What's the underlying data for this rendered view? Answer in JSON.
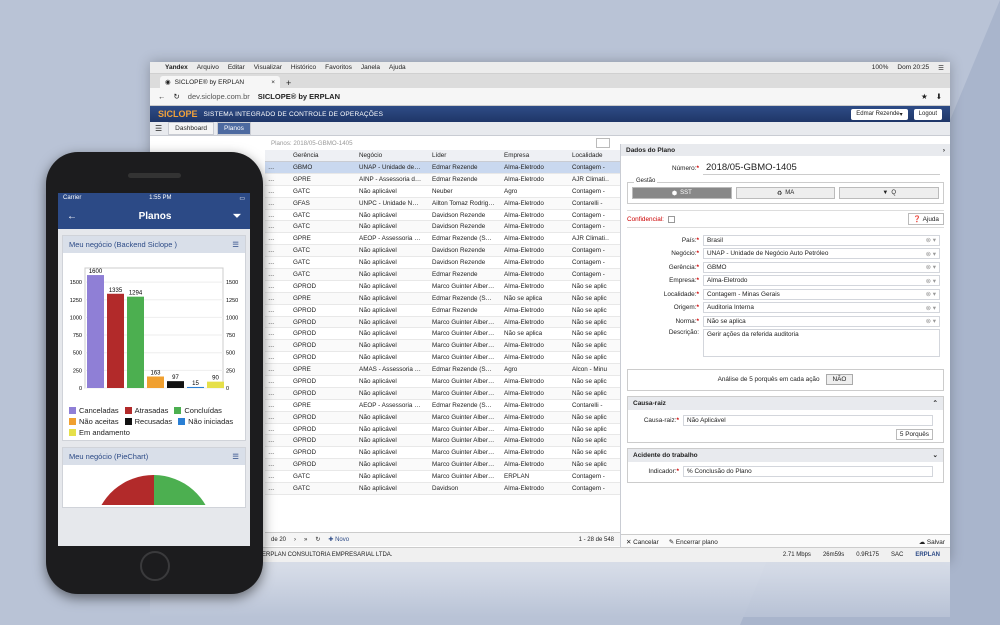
{
  "mac": {
    "apple": "",
    "app": "Yandex",
    "menus": [
      "Arquivo",
      "Editar",
      "Visualizar",
      "Histórico",
      "Favoritos",
      "Janela",
      "Ajuda"
    ],
    "battery": "100%",
    "clock": "Dom 20:25"
  },
  "browser": {
    "tab": "SICLOPE® by ERPLAN",
    "url": "dev.siclope.com.br",
    "page_title": "SICLOPE® by ERPLAN"
  },
  "app": {
    "logo": "SICLOPE",
    "subtitle": "SISTEMA INTEGRADO DE CONTROLE DE OPERAÇÕES",
    "user": "Edmar Rezende",
    "logout": "Logout",
    "tabs": [
      "Dashboard",
      "Planos"
    ],
    "breadcrumb": "Planos: 2018/05-GBMO-1405"
  },
  "grid": {
    "headers": [
      "",
      "Gerência",
      "Negócio",
      "Líder",
      "Empresa",
      "Localidade"
    ],
    "rows": [
      [
        "…",
        "GBMO",
        "UNAP - Unidade de…",
        "Edmar Rezende",
        "Alma-Eletrodo",
        "Contagem -"
      ],
      [
        "…",
        "GPRE",
        "AINP - Assessoria d…",
        "Edmar Rezende",
        "Alma-Eletrodo",
        "AJR Climati…"
      ],
      [
        "…",
        "GATC",
        "Não aplicável",
        "Neuber",
        "Agro",
        "Contagem -"
      ],
      [
        "…",
        "GFAS",
        "UNPC - Unidade N…",
        "Ailton Tomaz Rodrig…",
        "Alma-Eletrodo",
        "Contarelli -"
      ],
      [
        "…",
        "GATC",
        "Não aplicável",
        "Davidson Rezende",
        "Alma-Eletrodo",
        "Contagem -"
      ],
      [
        "…",
        "GATC",
        "Não aplicável",
        "Davidson Rezende",
        "Alma-Eletrodo",
        "Contagem -"
      ],
      [
        "…",
        "GPRE",
        "AEOP - Assessoria …",
        "Edmar Rezende (S…",
        "Alma-Eletrodo",
        "AJR Climati…"
      ],
      [
        "…",
        "GATC",
        "Não aplicável",
        "Davidson Rezende",
        "Alma-Eletrodo",
        "Contagem -"
      ],
      [
        "…",
        "GATC",
        "Não aplicável",
        "Davidson Rezende",
        "Alma-Eletrodo",
        "Contagem -"
      ],
      [
        "…",
        "GATC",
        "Não aplicável",
        "Edmar Rezende",
        "Alma-Eletrodo",
        "Contagem -"
      ],
      [
        "…",
        "GPROD",
        "Não aplicável",
        "Marco Guinter Alber…",
        "Alma-Eletrodo",
        "Não se aplic"
      ],
      [
        "…",
        "GPRE",
        "Não aplicável",
        "Edmar Rezende (S…",
        "Não se aplica",
        "Não se aplic"
      ],
      [
        "…",
        "GPROD",
        "Não aplicável",
        "Edmar Rezende",
        "Alma-Eletrodo",
        "Não se aplic"
      ],
      [
        "…",
        "GPROD",
        "Não aplicável",
        "Marco Guinter Alber…",
        "Alma-Eletrodo",
        "Não se aplic"
      ],
      [
        "…",
        "GPROD",
        "Não aplicável",
        "Marco Guinter Alber…",
        "Não se aplica",
        "Não se aplic"
      ],
      [
        "…",
        "GPROD",
        "Não aplicável",
        "Marco Guinter Alber…",
        "Alma-Eletrodo",
        "Não se aplic"
      ],
      [
        "…",
        "GPROD",
        "Não aplicável",
        "Marco Guinter Alber…",
        "Alma-Eletrodo",
        "Não se aplic"
      ],
      [
        "…",
        "GPRE",
        "AMAS - Assessoria …",
        "Edmar Rezende (S…",
        "Agro",
        "Alcon - Minu"
      ],
      [
        "…",
        "GPROD",
        "Não aplicável",
        "Marco Guinter Alber…",
        "Alma-Eletrodo",
        "Não se aplic"
      ],
      [
        "…",
        "GPROD",
        "Não aplicável",
        "Marco Guinter Alber…",
        "Alma-Eletrodo",
        "Não se aplic"
      ],
      [
        "…",
        "GPRE",
        "AEOP - Assessoria …",
        "Edmar Rezende (S…",
        "Alma-Eletrodo",
        "Contarelli -"
      ],
      [
        "…",
        "GPROD",
        "Não aplicável",
        "Marco Guinter Alber…",
        "Alma-Eletrodo",
        "Não se aplic"
      ],
      [
        "…",
        "GPROD",
        "Não aplicável",
        "Marco Guinter Alber…",
        "Alma-Eletrodo",
        "Não se aplic"
      ],
      [
        "…",
        "GPROD",
        "Não aplicável",
        "Marco Guinter Alber…",
        "Alma-Eletrodo",
        "Não se aplic"
      ],
      [
        "…",
        "GPROD",
        "Não aplicável",
        "Marco Guinter Alber…",
        "Alma-Eletrodo",
        "Não se aplic"
      ],
      [
        "…",
        "GPROD",
        "Não aplicável",
        "Marco Guinter Alber…",
        "Alma-Eletrodo",
        "Não se aplic"
      ],
      [
        "…",
        "GATC",
        "Não aplicável",
        "Marco Guinter Alber…",
        "ERPLAN",
        "Contagem -"
      ],
      [
        "…",
        "GATC",
        "Não aplicável",
        "Davidson",
        "Alma-Eletrodo",
        "Contagem -"
      ]
    ],
    "footer": {
      "pages": "de 20",
      "new": "Novo",
      "count": "1 - 28 de 548"
    }
  },
  "form": {
    "title": "Dados do Plano",
    "numero_label": "Número:",
    "numero": "2018/05-GBMO-1405",
    "gestao_label": "Gestão",
    "gestao": [
      "SST",
      "MA",
      "Q"
    ],
    "confidencial": "Confidencial:",
    "ajuda": "Ajuda",
    "fields": [
      {
        "label": "País:",
        "value": "Brasil"
      },
      {
        "label": "Negócio:",
        "value": "UNAP - Unidade de Negócio Auto Petróleo"
      },
      {
        "label": "Gerência:",
        "value": "GBMO"
      },
      {
        "label": "Empresa:",
        "value": "Alma-Eletrodo"
      },
      {
        "label": "Localidade:",
        "value": "Contagem - Minas Gerais"
      },
      {
        "label": "Origem:",
        "value": "Auditoria Interna"
      },
      {
        "label": "Norma:",
        "value": "Não se aplica"
      }
    ],
    "descricao_label": "Descrição:",
    "descricao": "Gerir ações da referida auditoria",
    "analise": "Análise de 5 porquês em cada ação",
    "analise_toggle": "NÃO",
    "causa_title": "Causa-raiz",
    "causa_label": "Causa-raiz:",
    "causa": "Não Aplicável",
    "porques": "5 Porquês",
    "acidente_title": "Acidente do trabalho",
    "indicador_label": "Indicador:",
    "indicador": "% Conclusão do Plano",
    "cancelar": "Cancelar",
    "encerrar": "Encerrar plano",
    "salvar": "Salvar"
  },
  "status": {
    "company": "ERPLAN CONSULTORIA EMPRESARIAL LTDA.",
    "speed": "2.71 Mbps",
    "time": "26m59s",
    "ver": "0.9R175",
    "sac": "SAC",
    "brand": "ERPLAN"
  },
  "phone": {
    "carrier": "Carrier",
    "clock": "1:55 PM",
    "title": "Planos",
    "card1": "Meu negócio (Backend Siclope )",
    "card2": "Meu negócio (PieChart)"
  },
  "chart_data": {
    "type": "bar",
    "categories": [
      "Canceladas",
      "Atrasadas",
      "Concluídas",
      "Não aceitas",
      "Recusadas",
      "Não iniciadas",
      "Em andamento"
    ],
    "values": [
      1600,
      1335,
      1294,
      163,
      97,
      15,
      90
    ],
    "colors": [
      "#8f7fd6",
      "#b22a2a",
      "#4caf50",
      "#f0a030",
      "#111111",
      "#2a7fd4",
      "#e6e04a"
    ],
    "ylim": [
      0,
      1600
    ],
    "yticks": [
      0,
      250,
      500,
      750,
      1000,
      1250,
      1500
    ]
  }
}
